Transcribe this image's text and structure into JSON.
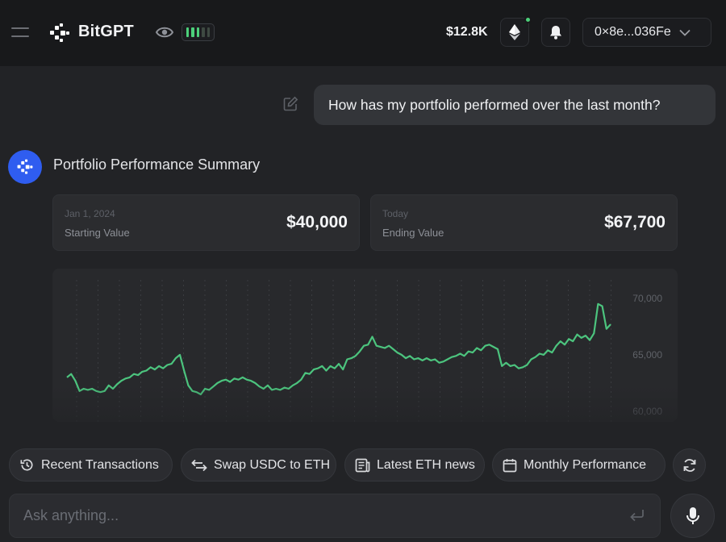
{
  "header": {
    "brand": "BitGPT",
    "balance": "$12.8K",
    "wallet_address": "0×8e...036Fe",
    "notification_dot_color": "#4cd07a",
    "battery_level": 0.6,
    "icons": [
      "menu-icon",
      "bitgpt-logo-icon",
      "eye-icon",
      "battery-icon",
      "ethereum-icon",
      "bell-icon",
      "chevron-down-icon"
    ]
  },
  "conversation": {
    "user_message": "How has my portfolio performed over the last month?",
    "assistant_title": "Portfolio Performance Summary",
    "accent_color": "#2f5df0"
  },
  "summary": {
    "start": {
      "date": "Jan 1, 2024",
      "label": "Starting Value",
      "value": "$40,000"
    },
    "end": {
      "date": "Today",
      "label": "Ending Value",
      "value": "$67,700"
    }
  },
  "chart_data": {
    "type": "line",
    "line_color": "#4cc47e",
    "y_ticks": [
      "70,000",
      "65,000",
      "60,000"
    ],
    "ylim": [
      59500,
      71200
    ],
    "grid": true,
    "series": [
      {
        "values": [
          63000,
          63300,
          62700,
          61800,
          62000,
          61900,
          62000,
          61800,
          61700,
          61800,
          62300,
          62000,
          62400,
          62700,
          62900,
          63000,
          63300,
          63200,
          63500,
          63600,
          63900,
          63700,
          64000,
          63800,
          64100,
          64200,
          64700,
          65000,
          63600,
          62300,
          61800,
          61700,
          61500,
          62000,
          61900,
          62200,
          62500,
          62700,
          62800,
          62600,
          62900,
          62800,
          63000,
          62800,
          62700,
          62500,
          62200,
          62000,
          62300,
          61900,
          62000,
          61900,
          62100,
          62000,
          62300,
          62500,
          62800,
          63400,
          63300,
          63700,
          63800,
          64000,
          63600,
          64000,
          63800,
          64200,
          63700,
          64600,
          64700,
          64900,
          65300,
          65800,
          65900,
          66600,
          65800,
          65700,
          65600,
          65800,
          65500,
          65200,
          65000,
          64700,
          64900,
          64600,
          64700,
          64500,
          64700,
          64500,
          64600,
          64300,
          64400,
          64600,
          64800,
          64900,
          65100,
          64900,
          65300,
          65200,
          65600,
          65400,
          65800,
          65900,
          65700,
          65500,
          64000,
          64300,
          64000,
          64100,
          63800,
          63900,
          64100,
          64600,
          64800,
          65100,
          65000,
          65400,
          65200,
          65800,
          66200,
          65900,
          66400,
          66200,
          66800,
          66500,
          66700,
          66300,
          66900,
          69500,
          69300,
          67300,
          67700
        ]
      }
    ]
  },
  "suggestions": [
    {
      "label": "Recent Transactions",
      "icon": "history-icon"
    },
    {
      "label": "Swap USDC to ETH",
      "icon": "swap-arrows-icon"
    },
    {
      "label": "Latest ETH news",
      "icon": "newspaper-icon"
    },
    {
      "label": "Monthly Performance",
      "icon": "calendar-icon"
    }
  ],
  "input": {
    "placeholder": "Ask anything..."
  }
}
